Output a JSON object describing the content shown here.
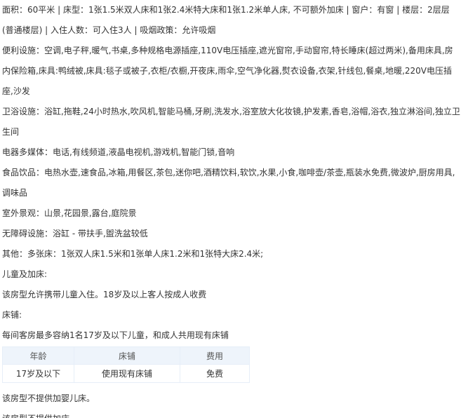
{
  "room_info": {
    "line1": "面积：60平米 | 床型：1张1.5米双人床和1张2.4米特大床和1张1.2米单人床, 不可额外加床 | 窗户：有窗 | 楼层：2层层",
    "line2": "(普通楼层) | 入住人数：可入住3人 | 吸烟政策：允许吸烟"
  },
  "facilities": [
    {
      "label": "便利设施：",
      "value": "空调,电子秤,暖气,书桌,多种规格电源插座,110V电压插座,遮光窗帘,手动窗帘,特长睡床(超过两米),备用床具,房内保险箱,床具:鸭绒被,床具:毯子或被子,衣柜/衣橱,开夜床,雨伞,空气净化器,熨衣设备,衣架,针线包,餐桌,地暖,220V电压插座,沙发"
    },
    {
      "label": "卫浴设施：",
      "value": "浴缸,拖鞋,24小时热水,吹风机,智能马桶,牙刷,洗发水,浴室放大化妆镜,护发素,香皂,浴帽,浴衣,独立淋浴间,独立卫生间"
    },
    {
      "label": "电器多媒体：",
      "value": "电话,有线频道,液晶电视机,游戏机,智能门锁,音响"
    },
    {
      "label": "食品饮品：",
      "value": "电热水壶,速食品,冰箱,用餐区,茶包,迷你吧,酒精饮料,软饮,水果,小食,咖啡壶/茶壶,瓶装水免费,微波炉,厨房用具,调味品"
    },
    {
      "label": "室外景观：",
      "value": "山景,花园景,露台,庭院景"
    },
    {
      "label": "无障碍设施：",
      "value": "浴缸 - 带扶手,盥洗盆较低"
    },
    {
      "label": "其他：",
      "value": "多张床：1张双人床1.5米和1张单人床1.2米和1张特大床2.4米;"
    }
  ],
  "children_policy": {
    "heading": "儿童及加床:",
    "allow_text": "该房型允许携带儿童入住。18岁及以上客人按成人收费",
    "bed_heading": "床铺:",
    "bed_text": "每间客房最多容纳1名17岁及以下儿童，和成人共用现有床铺",
    "table": {
      "headers": [
        "年龄",
        "床铺",
        "费用"
      ],
      "rows": [
        [
          "17岁及以下",
          "使用现有床铺",
          "免费"
        ]
      ]
    },
    "crib_text": "该房型不提供加婴儿床。",
    "extra_bed_text": "该房型不提供加床。"
  },
  "colors": {
    "text": "#333333",
    "table_header_bg": "#eef4fb",
    "table_border": "#e6eef8",
    "fee_free": "#2a7fd4"
  }
}
